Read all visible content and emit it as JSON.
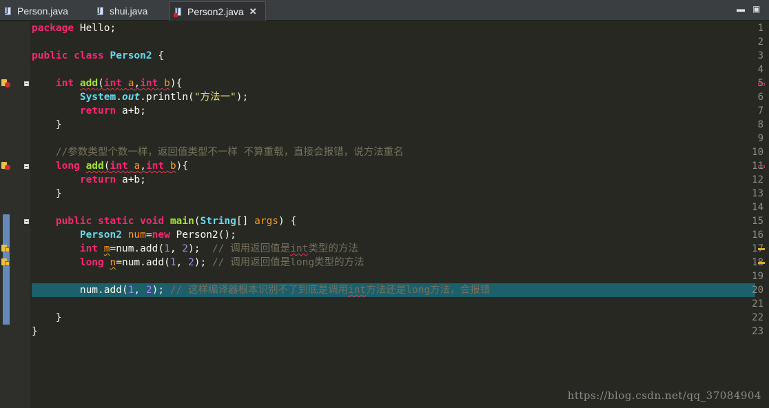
{
  "tabs": [
    {
      "label": "Person.java"
    },
    {
      "label": "shui.java"
    },
    {
      "label": "Person2.java"
    }
  ],
  "editor": {
    "line_numbers": [
      "1",
      "2",
      "3",
      "4",
      "5",
      "6",
      "7",
      "8",
      "9",
      "10",
      "11",
      "12",
      "13",
      "14",
      "15",
      "16",
      "17",
      "18",
      "19",
      "20",
      "21",
      "22",
      "23"
    ],
    "code": {
      "l1": {
        "kw": "package",
        "rest": " Hello;"
      },
      "l3": {
        "kw1": "public",
        "kw2": "class",
        "name": "Person2",
        "rest": " {"
      },
      "l5": {
        "type1": "int",
        "fn": "add",
        "open": "(",
        "type2": "int",
        "p1": "a",
        "comma": ",",
        "type3": "int",
        "p2": "b",
        "close": "){"
      },
      "l6": {
        "sys": "System",
        "dot1": ".",
        "out": "out",
        "dot2": ".println(",
        "str": "\"方法一\"",
        "end": ");"
      },
      "l7": {
        "kw": "return",
        "rest": " a+b;"
      },
      "l8": {
        "text": "}"
      },
      "l10": {
        "comment": "//参数类型个数一样，返回值类型不一样 不算重载，直接会报错，说方法重名"
      },
      "l11": {
        "type1": "long",
        "fn": "add",
        "open": "(",
        "type2": "int",
        "p1": "a",
        "comma": ",",
        "type3": "int",
        "p2": "b",
        "close": "){"
      },
      "l12": {
        "kw": "return",
        "rest": " a+b;"
      },
      "l13": {
        "text": "}"
      },
      "l15": {
        "kw1": "public",
        "kw2": "static",
        "kw3": "void",
        "fn": "main",
        "open": "(",
        "type": "String",
        "bracket": "[] ",
        "param": "args",
        "close": ") {"
      },
      "l16": {
        "type": "Person2",
        "var": "num",
        "eq": "=",
        "kw": "new",
        "rest": " Person2();"
      },
      "l17": {
        "type": "int",
        "var": "m",
        "rest1": "=num.add(",
        "n1": "1",
        "sep": ", ",
        "n2": "2",
        "rest2": ");  ",
        "c1": "// 调用返回值是",
        "c2": "int",
        "c3": "类型的方法"
      },
      "l18": {
        "type": "long",
        "var": "n",
        "rest1": "=num.add(",
        "n1": "1",
        "sep": ", ",
        "n2": "2",
        "rest2": "); ",
        "c1": "// 调用返回值是long类型的方法"
      },
      "l20": {
        "rest1": "num.add(",
        "n1": "1",
        "sep": ", ",
        "n2": "2",
        "rest2": "); ",
        "c1": "// 这样编译器根本识别不了到底是调用",
        "c2": "int",
        "c3": "方法还是long方法，会报错"
      },
      "l22": {
        "text": "}"
      },
      "l23": {
        "text": "}"
      }
    }
  },
  "colors": {
    "keyword": "#f92672",
    "type": "#66d9ef",
    "function": "#a6e22e",
    "string": "#e6db74",
    "number": "#ae81ff",
    "comment": "#75715e",
    "current_line": "#1d5f6b",
    "background": "#272822"
  },
  "watermark": "https://blog.csdn.net/qq_37084904",
  "icons": [
    "java-file-icon",
    "close-icon",
    "minimize-icon",
    "maximize-icon",
    "error-marker-icon",
    "warning-marker-icon",
    "fold-icon"
  ]
}
